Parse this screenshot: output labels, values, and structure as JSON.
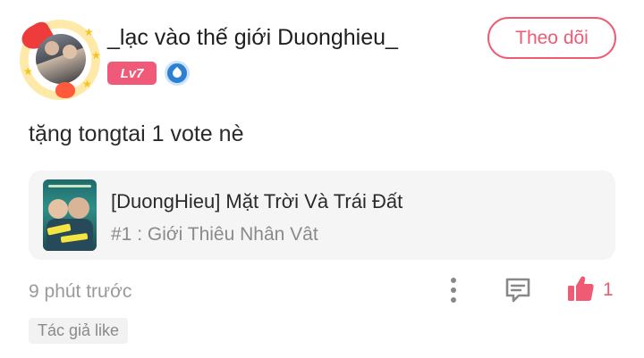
{
  "comment": {
    "author": {
      "username": "_lạc vào thế giới Duonghieu_",
      "level": "Lv7",
      "rank_icon": "water-drop-badge-icon"
    },
    "follow_label": "Theo dõi",
    "text": "tặng tongtai 1 vote nè",
    "story": {
      "title": "[DuongHieu] Mặt Trời Và Trái Đất",
      "chapter": "#1 : Giới Thiêu Nhân Vât"
    },
    "timestamp": "9 phút trước",
    "actions": {
      "more_icon": "more-vertical-icon",
      "reply_icon": "comment-icon",
      "like_icon": "thumbs-up-icon",
      "like_count": "1"
    },
    "author_like_badge": "Tác giả like"
  },
  "colors": {
    "accent": "#ef5b72",
    "level_badge": "#f05a78",
    "rank_badge": "#2d7fd3",
    "muted_text": "#9a9a9a",
    "card_bg": "#f5f5f5"
  }
}
